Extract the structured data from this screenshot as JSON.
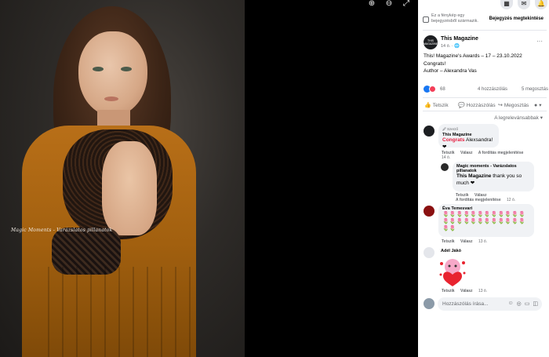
{
  "viewer": {
    "watermark": "Magic Moments - Varázslatos pillanatok",
    "controls": {
      "zoom_in": "⊕",
      "zoom_out": "⊖",
      "fullscreen": "⤢"
    }
  },
  "topbar": {
    "menu": "▦",
    "messenger": "✉",
    "notifications": "🔔"
  },
  "notice": {
    "text": "Ez a fénykép egy bejegyzésből származik.",
    "link": "Bejegyzés megtekintése"
  },
  "post": {
    "author_initials": "THIS MAGAZINE",
    "author": "This Magazine",
    "time": "14 ó. · 🌐",
    "more": "···",
    "caption_line1": "This! Magazine's Awards – 17 – 23.10.2022",
    "caption_line2": "Congrats!",
    "caption_line3": "Author – Alexandra Vas",
    "reaction_count": "68",
    "comments": "4 hozzászólás",
    "shares": "5 megosztás",
    "actions": {
      "like": "Tetszik",
      "comment": "Hozzászólás",
      "share": "Megosztás"
    },
    "sort": "A legrelevánsabbak ▾"
  },
  "comments": [
    {
      "badge": "🖉 Szerző",
      "name": "This Magazine",
      "highlight": "Congrats",
      "text": " Alexsandra! ❤",
      "actions": [
        "Tetszik",
        "Válasz",
        "A fordítás megjelenítése"
      ],
      "time": "14 ó."
    },
    {
      "name": "Magic moments - Varázslatos pillanatok",
      "mention": "This Magazine",
      "text": " thank you so much ❤",
      "actions": [
        "Tetszik",
        "Válasz"
      ],
      "extra": "A fordítás megjelenítése",
      "time": "12 ó."
    },
    {
      "name": "Éva Temesvari",
      "emoji_line1": "🌷🌷🌷🌷🌷🌷🌷🌷🌷🌷🌷🌷",
      "emoji_line2": "🌷🌷🌷🌷🌷🌷🌷🌷🌷🌷🌷🌷",
      "emoji_line3": "🌷🌷",
      "actions": [
        "Tetszik",
        "Válasz"
      ],
      "time": "13 ó."
    },
    {
      "name": "Adél Jákó",
      "actions": [
        "Tetszik",
        "Válasz"
      ],
      "time": "13 ó."
    }
  ],
  "input": {
    "placeholder": "Hozzászólás írása...",
    "icons": [
      "☺",
      "◎",
      "▭",
      "◫"
    ]
  }
}
